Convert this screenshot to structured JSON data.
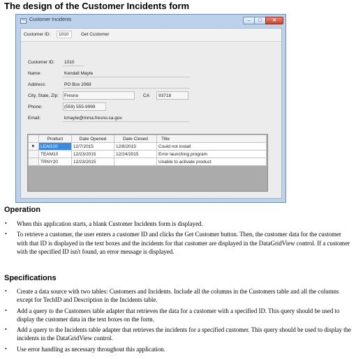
{
  "page_title": "The design of the Customer Incidents form",
  "window": {
    "title": "Customer Incidents",
    "buttons": {
      "minimize": "–",
      "maximize": "□",
      "close": "✕"
    },
    "toolstrip": {
      "customer_id_label": "Customer ID:",
      "customer_id_value": "1010",
      "get_customer_label": "Get Customer"
    },
    "fields": {
      "customer_id_label": "Customer ID:",
      "customer_id_value": "1010",
      "name_label": "Name:",
      "name_value": "Kendall Mayte",
      "address_label": "Address:",
      "address_value": "PO Box 2069",
      "city_label": "City, State, Zip:",
      "city_value": "Fresno",
      "state_value": "CA",
      "zip_value": "93718",
      "phone_label": "Phone:",
      "phone_value": "(559) 555-9999",
      "email_label": "Email:",
      "email_value": "kmayte@mma.fresno.ca.gov"
    },
    "grid": {
      "columns": [
        "Product",
        "Date Opened",
        "Date Closed",
        "Title"
      ],
      "current_row_marker": "►",
      "rows": [
        [
          "LEAG10",
          "12/7/2015",
          "12/8/2015",
          "Could not install"
        ],
        [
          "TEAM10",
          "12/23/2015",
          "12/24/2015",
          "Error launching program"
        ],
        [
          "TRNY20",
          "12/23/2015",
          "",
          "Unable to activate product"
        ]
      ]
    }
  },
  "operation": {
    "heading": "Operation",
    "bullets": [
      "When this application starts, a blank Customer Incidents form is displayed.",
      "To retrieve a customer, the user enters a customer ID and clicks the Get Customer button. Then, the customer data for the customer with that ID is displayed in the text boxes and the incidents for that customer are displayed in the DataGridView control. If a customer with the specified ID isn't found, an error message is displayed."
    ]
  },
  "specifications": {
    "heading": "Specifications",
    "bullets": [
      "Create a data source with two tables: Customers and Incidents. Include all the columns in the Customers table and all the columns except for TechID and Description in the Incidents table.",
      "Add a query to the Customers table adapter that retrieves the data for a customer with a specified ID. This query should be used to display the customer data in the text boxes on the form.",
      "Add a query to the Incidents table adapter that retrieves the incidents for a specified customer. This query should be used to display the incidents in the DataGridView control.",
      "Use error handling as necessary throughout this application."
    ]
  },
  "bullet_glyph": "•"
}
